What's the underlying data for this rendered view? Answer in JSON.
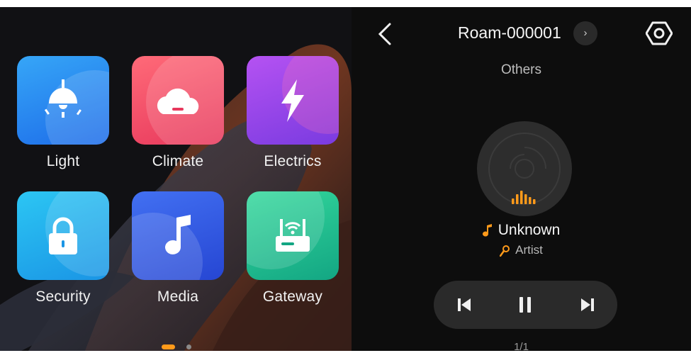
{
  "home": {
    "tiles": [
      {
        "label": "Light",
        "icon": "lamp-icon",
        "color_top": "#2f9bf5",
        "color_bottom": "#1f6fe8"
      },
      {
        "label": "Climate",
        "icon": "cloud-icon",
        "color_top": "#ff5a73",
        "color_bottom": "#e8365a"
      },
      {
        "label": "Electrics",
        "icon": "lightning-icon",
        "color_top": "#b14cf0",
        "color_bottom": "#7a3ae0"
      },
      {
        "label": "Security",
        "icon": "lock-icon",
        "color_top": "#2cc3f2",
        "color_bottom": "#1a97e6"
      },
      {
        "label": "Media",
        "icon": "music-note-icon",
        "color_top": "#3c68f0",
        "color_bottom": "#2747d4"
      },
      {
        "label": "Gateway",
        "icon": "router-icon",
        "color_top": "#2fd39a",
        "color_bottom": "#14a783"
      }
    ],
    "page_indicator": {
      "count": 2,
      "active": 1,
      "active_color": "#ff9a1a"
    }
  },
  "player": {
    "device_name": "Roam-000001",
    "room": "Others",
    "song": "Unknown",
    "artist": "Artist",
    "counter": "1/1",
    "accent": "#ff9a1a",
    "state": "playing"
  }
}
